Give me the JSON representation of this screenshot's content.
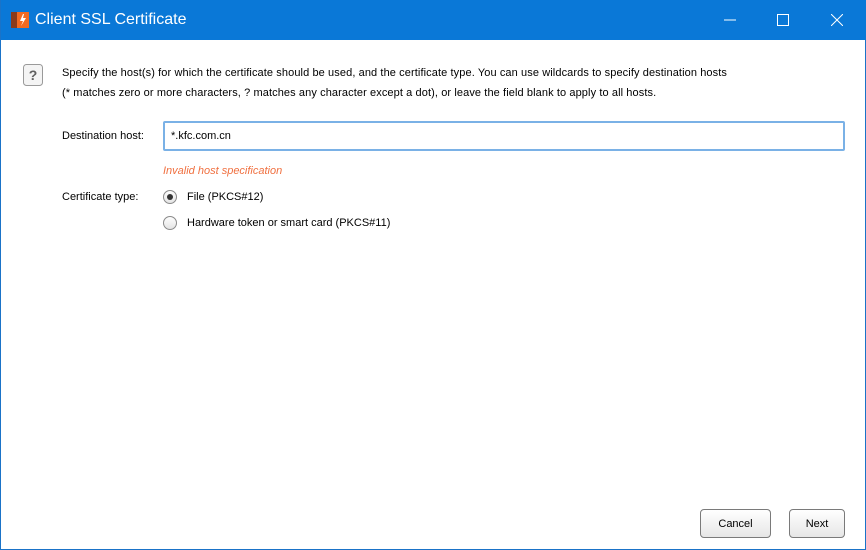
{
  "window": {
    "title": "Client SSL Certificate",
    "icon": "app-logo-icon",
    "controls": [
      "minimize-icon",
      "maximize-icon",
      "close-icon"
    ],
    "accent_color": "#0a78d7"
  },
  "description": {
    "line1": "Specify the host(s) for which the certificate should be used, and the certificate type. You can use wildcards to specify destination hosts",
    "line2": "(* matches zero or more characters, ? matches any character except a dot), or leave the field blank to apply to all hosts."
  },
  "form": {
    "destination_label": "Destination host:",
    "destination_value": "*.kfc.com.cn",
    "error_message": "Invalid host specification",
    "error_color": "#f07040",
    "certificate_type_label": "Certificate type:",
    "options": [
      {
        "label": "File (PKCS#12)",
        "selected": true
      },
      {
        "label": "Hardware token or smart card (PKCS#11)",
        "selected": false
      }
    ]
  },
  "buttons": {
    "cancel": "Cancel",
    "next": "Next"
  }
}
